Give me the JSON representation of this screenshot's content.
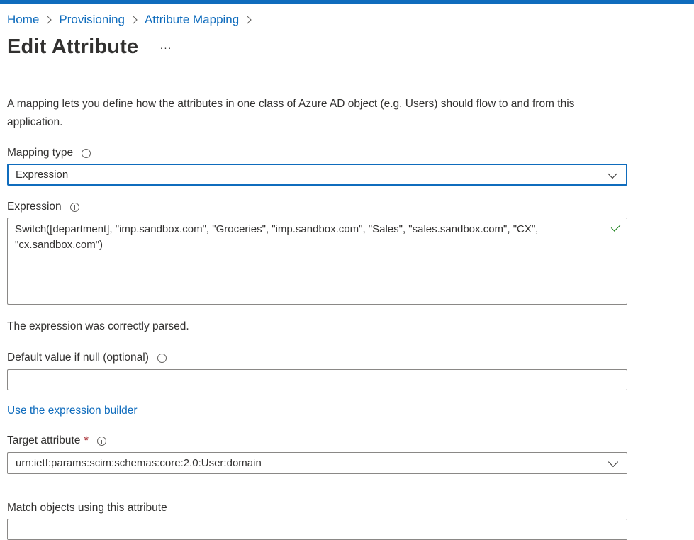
{
  "breadcrumb": {
    "items": [
      "Home",
      "Provisioning",
      "Attribute Mapping"
    ]
  },
  "page": {
    "title": "Edit Attribute",
    "more_label": "···",
    "description": "A mapping lets you define how the attributes in one class of Azure AD object (e.g. Users) should flow to and from this application."
  },
  "mapping_type": {
    "label": "Mapping type",
    "value": "Expression"
  },
  "expression": {
    "label": "Expression",
    "value": "Switch([department], \"imp.sandbox.com\", \"Groceries\", \"imp.sandbox.com\", \"Sales\", \"sales.sandbox.com\", \"CX\", \"cx.sandbox.com\")",
    "status": "The expression was correctly parsed."
  },
  "default_value": {
    "label": "Default value if null (optional)",
    "value": ""
  },
  "expression_builder_link": "Use the expression builder",
  "target_attribute": {
    "label": "Target attribute",
    "required_mark": "*",
    "value": "urn:ietf:params:scim:schemas:core:2.0:User:domain"
  },
  "match_objects": {
    "label": "Match objects using this attribute"
  },
  "colors": {
    "accent": "#0f6cbd",
    "success": "#107c10",
    "required": "#a4262c"
  }
}
